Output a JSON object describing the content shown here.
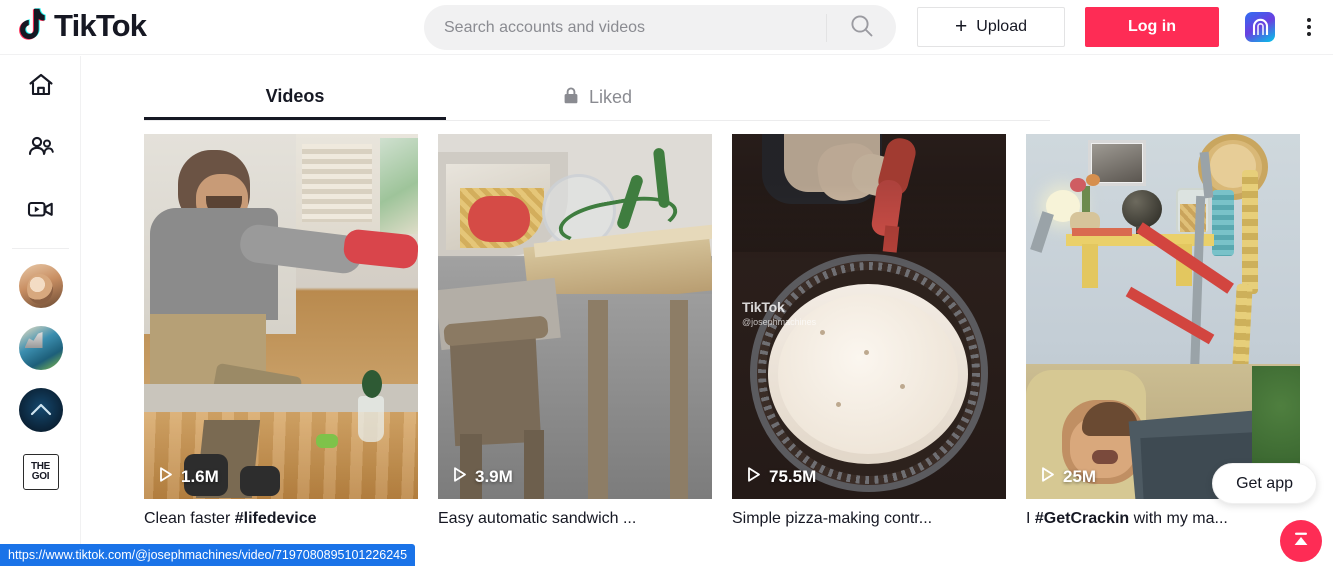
{
  "header": {
    "logo_text": "TikTok",
    "logo_icon": "tiktok-note-icon",
    "search": {
      "placeholder": "Search accounts and videos",
      "value": "",
      "icon": "search-icon"
    },
    "upload_label": "Upload",
    "upload_icon": "plus-icon",
    "login_label": "Log in",
    "extension_icon": "arch-gradient-extension-icon",
    "menu_icon": "kebab-menu-icon"
  },
  "sidebar": {
    "nav": [
      {
        "name": "home",
        "icon": "home-icon"
      },
      {
        "name": "following",
        "icon": "people-icon"
      },
      {
        "name": "live",
        "icon": "video-camera-icon"
      }
    ],
    "accounts": [
      {
        "name": "suggested-account-1",
        "icon": "avatar-photo"
      },
      {
        "name": "suggested-account-2",
        "icon": "avatar-photo"
      },
      {
        "name": "suggested-account-3",
        "icon": "avatar-chevron"
      },
      {
        "name": "suggested-account-4",
        "icon": "avatar-the-goi",
        "line1": "THE",
        "line2": "GOI"
      }
    ]
  },
  "tabs": [
    {
      "label": "Videos",
      "active": true,
      "icon": ""
    },
    {
      "label": "Liked",
      "active": false,
      "icon": "lock-icon"
    }
  ],
  "videos": [
    {
      "views": "1.6M",
      "caption_pre": "Clean faster ",
      "caption_tag": "#lifedevice",
      "caption_post": "",
      "play_icon": "play-icon"
    },
    {
      "views": "3.9M",
      "caption_pre": "Easy automatic sandwich ...",
      "caption_tag": "",
      "caption_post": "",
      "play_icon": "play-icon"
    },
    {
      "views": "75.5M",
      "caption_pre": "Simple pizza-making contr...",
      "caption_tag": "",
      "caption_post": "",
      "play_icon": "play-icon",
      "watermark_title": "TikTok",
      "watermark_handle": "@josephmachines"
    },
    {
      "views": "25M",
      "caption_pre": "I ",
      "caption_tag": "#GetCrackin",
      "caption_post": " with my ma...",
      "play_icon": "play-icon"
    }
  ],
  "floating": {
    "get_app_label": "Get app",
    "scroll_top_icon": "scroll-to-top-icon"
  },
  "status_bar": {
    "url": "https://www.tiktok.com/@josephmachines/video/7197080895101226245"
  },
  "colors": {
    "brand_red": "#FE2C55",
    "brand_cyan": "#25F4EE",
    "text": "#161823",
    "muted": "#8A8B91",
    "status_blue": "#1A73E8"
  }
}
